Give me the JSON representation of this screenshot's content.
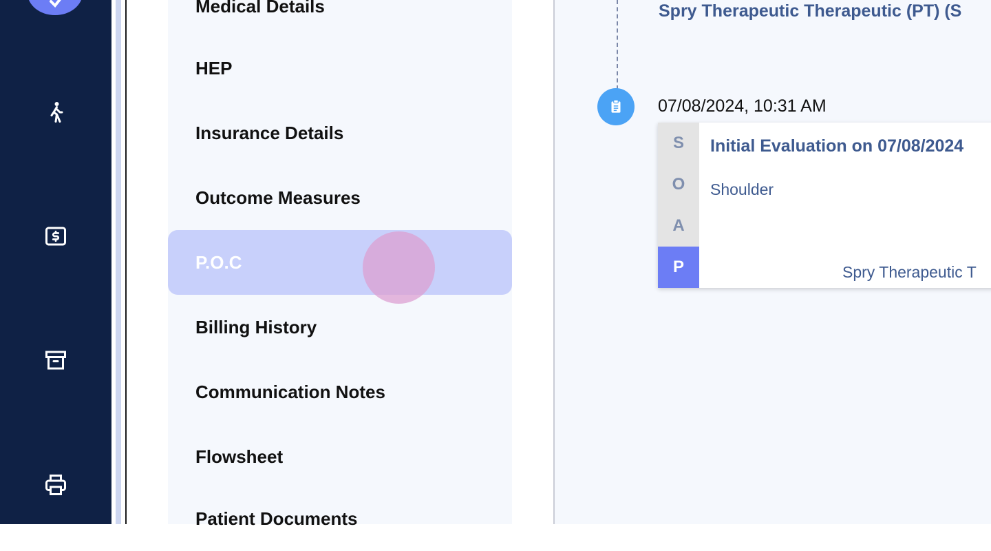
{
  "sidebar_icons": [
    "check-icon",
    "walking-person-icon",
    "billing-dollar-icon",
    "archive-box-icon",
    "printer-icon"
  ],
  "menu": {
    "items": [
      {
        "label": "Medical Details"
      },
      {
        "label": "HEP"
      },
      {
        "label": "Insurance Details"
      },
      {
        "label": "Outcome Measures"
      },
      {
        "label": "P.O.C",
        "active": true
      },
      {
        "label": "Billing History"
      },
      {
        "label": "Communication Notes"
      },
      {
        "label": "Flowsheet"
      },
      {
        "label": "Patient Documents"
      }
    ]
  },
  "timeline": {
    "top_provider": "Spry Therapeutic Therapeutic (PT) (S",
    "entry": {
      "date": "07/08/2024, 10:31 AM",
      "icon": "clipboard-icon",
      "soap": [
        "S",
        "O",
        "A",
        "P"
      ],
      "active_soap": "P",
      "title": "Initial Evaluation on 07/08/2024",
      "body": "Shoulder",
      "provider": "Spry Therapeutic T"
    }
  },
  "colors": {
    "rail": "#0f2145",
    "accent": "#6c7df5",
    "active_menu": "#c8d0fb",
    "text_blue": "#3e5a8f",
    "node": "#4ba3f5"
  }
}
